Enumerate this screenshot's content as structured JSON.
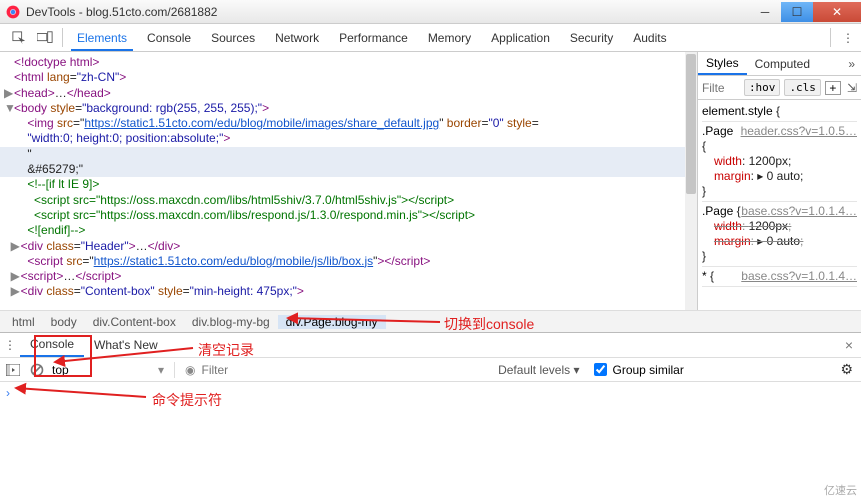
{
  "window": {
    "title": "DevTools - blog.51cto.com/2681882"
  },
  "toolbar": {
    "tabs": [
      "Elements",
      "Console",
      "Sources",
      "Network",
      "Performance",
      "Memory",
      "Application",
      "Security",
      "Audits"
    ],
    "active_index": 0
  },
  "dom_lines": [
    {
      "indent": 0,
      "tri": "",
      "segs": [
        {
          "t": "tag",
          "v": "<!doctype html>"
        }
      ]
    },
    {
      "indent": 0,
      "tri": "",
      "segs": [
        {
          "t": "tag",
          "v": "<html "
        },
        {
          "t": "attr-n",
          "v": "lang"
        },
        {
          "t": "txt",
          "v": "="
        },
        {
          "t": "attr-v",
          "v": "\"zh-CN\""
        },
        {
          "t": "tag",
          "v": ">"
        }
      ]
    },
    {
      "indent": 0,
      "tri": "▶",
      "segs": [
        {
          "t": "tag",
          "v": "<head>"
        },
        {
          "t": "txt",
          "v": "…"
        },
        {
          "t": "tag",
          "v": "</head>"
        }
      ]
    },
    {
      "indent": 0,
      "tri": "▼",
      "segs": [
        {
          "t": "tag",
          "v": "<body "
        },
        {
          "t": "attr-n",
          "v": "style"
        },
        {
          "t": "txt",
          "v": "="
        },
        {
          "t": "attr-v",
          "v": "\"background: rgb(255, 255, 255);\""
        },
        {
          "t": "tag",
          "v": ">"
        }
      ]
    },
    {
      "indent": 2,
      "tri": "",
      "segs": [
        {
          "t": "tag",
          "v": "<img "
        },
        {
          "t": "attr-n",
          "v": "src"
        },
        {
          "t": "txt",
          "v": "=\""
        },
        {
          "t": "link",
          "v": "https://static1.51cto.com/edu/blog/mobile/images/share_default.jpg"
        },
        {
          "t": "txt",
          "v": "\" "
        },
        {
          "t": "attr-n",
          "v": "border"
        },
        {
          "t": "txt",
          "v": "="
        },
        {
          "t": "attr-v",
          "v": "\"0\""
        },
        {
          "t": "txt",
          "v": " "
        },
        {
          "t": "attr-n",
          "v": "style"
        },
        {
          "t": "txt",
          "v": "="
        }
      ]
    },
    {
      "indent": 2,
      "tri": "",
      "segs": [
        {
          "t": "attr-v",
          "v": "\"width:0; height:0; position:absolute;\""
        },
        {
          "t": "tag",
          "v": ">"
        }
      ]
    },
    {
      "indent": 2,
      "tri": "",
      "segs": [
        {
          "t": "txt",
          "v": "\""
        }
      ],
      "hl": true
    },
    {
      "indent": 2,
      "tri": "",
      "segs": [
        {
          "t": "txt",
          "v": "&#65279;\""
        }
      ],
      "hl": true
    },
    {
      "indent": 2,
      "tri": "",
      "segs": [
        {
          "t": "comment",
          "v": "<!--[if lt IE 9]>"
        }
      ]
    },
    {
      "indent": 3,
      "tri": "",
      "segs": [
        {
          "t": "comment",
          "v": "<script src=\"https://oss.maxcdn.com/libs/html5shiv/3.7.0/html5shiv.js\"></script>"
        }
      ]
    },
    {
      "indent": 3,
      "tri": "",
      "segs": [
        {
          "t": "comment",
          "v": "<script src=\"https://oss.maxcdn.com/libs/respond.js/1.3.0/respond.min.js\"></script>"
        }
      ]
    },
    {
      "indent": 2,
      "tri": "",
      "segs": [
        {
          "t": "comment",
          "v": "<![endif]-->"
        }
      ]
    },
    {
      "indent": 1,
      "tri": "▶",
      "segs": [
        {
          "t": "tag",
          "v": "<div "
        },
        {
          "t": "attr-n",
          "v": "class"
        },
        {
          "t": "txt",
          "v": "="
        },
        {
          "t": "attr-v",
          "v": "\"Header\""
        },
        {
          "t": "tag",
          "v": ">"
        },
        {
          "t": "txt",
          "v": "…"
        },
        {
          "t": "tag",
          "v": "</div>"
        }
      ]
    },
    {
      "indent": 2,
      "tri": "",
      "segs": [
        {
          "t": "tag",
          "v": "<script "
        },
        {
          "t": "attr-n",
          "v": "src"
        },
        {
          "t": "txt",
          "v": "=\""
        },
        {
          "t": "link",
          "v": "https://static1.51cto.com/edu/blog/mobile/js/lib/box.js"
        },
        {
          "t": "txt",
          "v": "\""
        },
        {
          "t": "tag",
          "v": "></script>"
        }
      ]
    },
    {
      "indent": 1,
      "tri": "▶",
      "segs": [
        {
          "t": "tag",
          "v": "<script>"
        },
        {
          "t": "txt",
          "v": "…"
        },
        {
          "t": "tag",
          "v": "</script>"
        }
      ]
    },
    {
      "indent": 1,
      "tri": "▶",
      "segs": [
        {
          "t": "tag",
          "v": "<div "
        },
        {
          "t": "attr-n",
          "v": "class"
        },
        {
          "t": "txt",
          "v": "="
        },
        {
          "t": "attr-v",
          "v": "\"Content-box\""
        },
        {
          "t": "txt",
          "v": " "
        },
        {
          "t": "attr-n",
          "v": "style"
        },
        {
          "t": "txt",
          "v": "="
        },
        {
          "t": "attr-v",
          "v": "\"min-height: 475px;\""
        },
        {
          "t": "tag",
          "v": ">"
        }
      ]
    }
  ],
  "breadcrumb": [
    "html",
    "body",
    "div.Content-box",
    "div.blog-my-bg",
    "div.Page.blog-my"
  ],
  "styles_panel": {
    "tabs": [
      "Styles",
      "Computed"
    ],
    "active_index": 0,
    "filter_placeholder": "Filte",
    "chips": [
      ":hov",
      ".cls"
    ],
    "rules": [
      {
        "src": "",
        "selector": "element.style",
        "props": [],
        "brace": "{"
      },
      {
        "src": "header.css?v=1.0.5…",
        "selector": ".Page",
        "props": [
          {
            "n": "width",
            "v": "1200px",
            "strike": false
          },
          {
            "n": "margin",
            "v": "▸ 0 auto",
            "strike": false
          }
        ]
      },
      {
        "src": "base.css?v=1.0.1.4…",
        "selector": ".Page",
        "props": [
          {
            "n": "width",
            "v": "1200px",
            "strike": true
          },
          {
            "n": "margin",
            "v": "▸ 0 auto",
            "strike": true
          }
        ]
      },
      {
        "src": "base.css?v=1.0.1.4…",
        "selector": "*",
        "props": [],
        "brace": "{"
      }
    ]
  },
  "drawer": {
    "tabs": [
      "Console",
      "What's New"
    ],
    "active_index": 0,
    "context": "top",
    "filter_placeholder": "Filter",
    "levels_label": "Default levels ▾",
    "group_label": "Group similar",
    "prompt": "›"
  },
  "annotations": {
    "switch_console": "切换到console",
    "clear_log": "清空记录",
    "prompt_label": "命令提示符"
  },
  "watermark": "亿速云"
}
